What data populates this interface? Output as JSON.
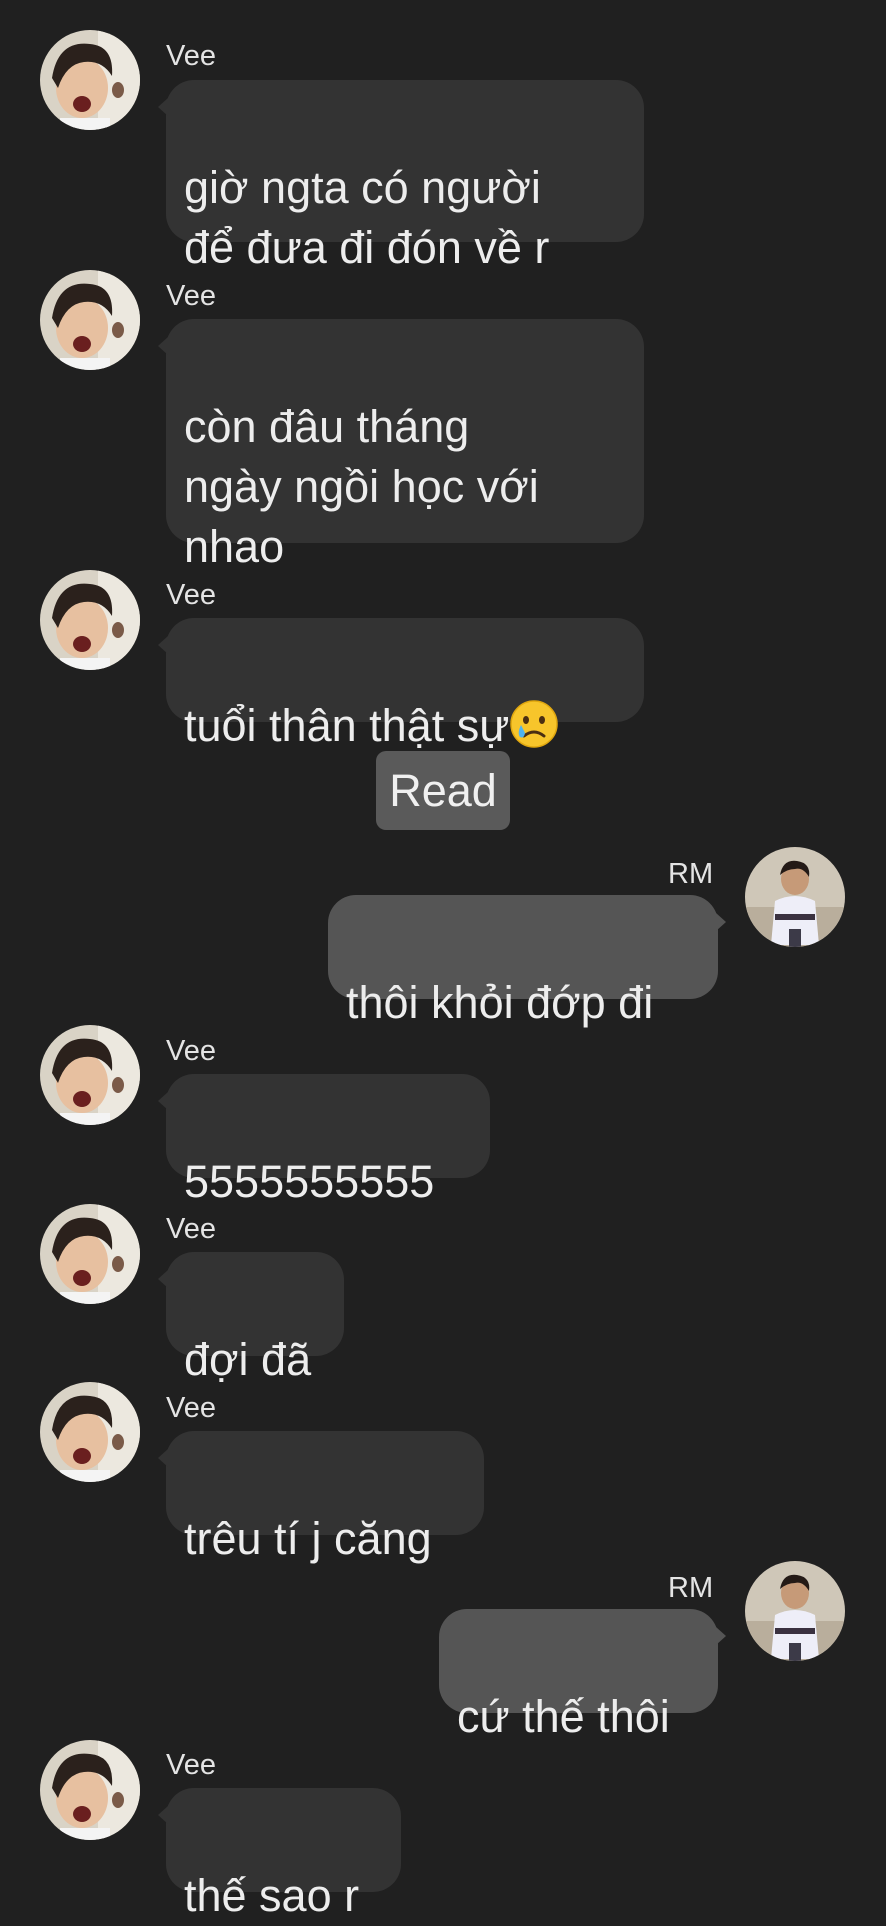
{
  "conversation": {
    "read_receipt": "Read",
    "messages": [
      {
        "sender": "Vee",
        "text": "giờ ngta có người\nđể đưa đi đón về r"
      },
      {
        "sender": "Vee",
        "text": "còn đâu tháng\nngày ngồi học với\nnhao"
      },
      {
        "sender": "Vee",
        "text": "tuổi thân thật sự",
        "emoji": "crying-face-emoji"
      },
      {
        "sender": "RM",
        "text": "thôi khỏi đớp đi"
      },
      {
        "sender": "Vee",
        "text": "5555555555"
      },
      {
        "sender": "Vee",
        "text": "đợi đã"
      },
      {
        "sender": "Vee",
        "text": "trêu tí j căng"
      },
      {
        "sender": "RM",
        "text": "cứ thế thôi"
      },
      {
        "sender": "Vee",
        "text": "thế sao r"
      }
    ]
  },
  "colors": {
    "background": "#202020",
    "incoming_bubble": "#333333",
    "outgoing_bubble": "#555555",
    "read_pill": "#5a5a5a"
  }
}
